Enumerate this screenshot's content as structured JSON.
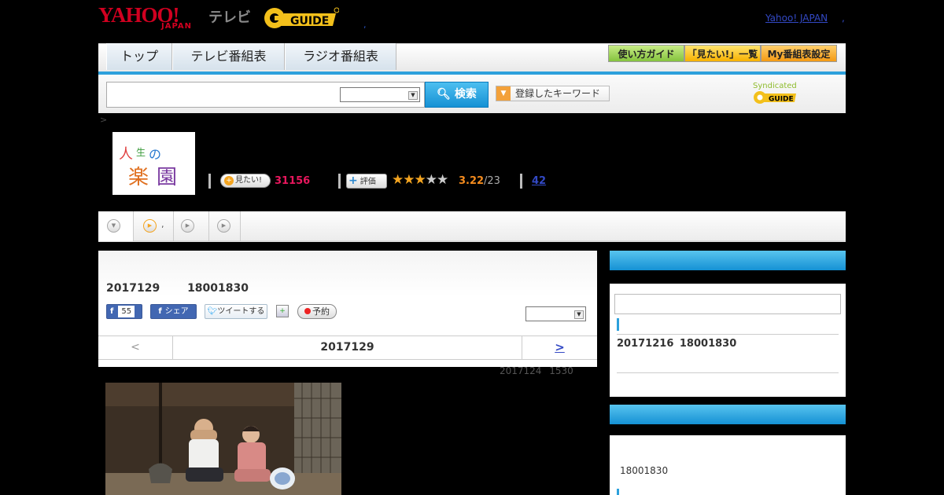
{
  "header": {
    "brand_yahoo": "YAHOO!",
    "brand_japan": "JAPAN",
    "brand_tv": "テレビ",
    "gguide_logo": "G-GUIDE",
    "separator": ",",
    "yahoo_japan_link": "Yahoo! JAPAN",
    "link_comma": ","
  },
  "nav": {
    "tabs": [
      "トップ",
      "テレビ番組表",
      "ラジオ番組表"
    ],
    "buttons": [
      "使い方ガイド",
      "「見たい!」一覧",
      "My番組表設定"
    ]
  },
  "search": {
    "input_value": "",
    "select_value": "",
    "button_label": "検索",
    "keyword_button_label": "登録したキーワード",
    "syndicated_label": "Syndicated"
  },
  "breadcrumb": ">",
  "program": {
    "thumbnail_alt": "人生の楽園",
    "mitai_label": "見たい!",
    "mitai_count": "31156",
    "eval_label": "評価",
    "rating_stars": 3,
    "rating_max_stars": 5,
    "rating_value": "3.22",
    "rating_count": "/23",
    "review_link": "42"
  },
  "tabs": {
    "tab2_label": ","
  },
  "main": {
    "airtime": "2017129 18001830",
    "fb_like_count": "55",
    "fb_share_label": "シェア",
    "tweet_label": "ツイートする",
    "reserve_label": "予約",
    "select_value": "",
    "pager_prev": "<",
    "pager_date": "2017129",
    "pager_next": ">",
    "updated": "2017124 1530"
  },
  "side": {
    "next_airtime": "20171216 18001830",
    "time2": "18001830"
  },
  "colors": {
    "accent_blue": "#2ca0dc",
    "pink_count": "#e8175d",
    "rating_orange": "#f48b1e",
    "link_blue": "#3349c5"
  }
}
